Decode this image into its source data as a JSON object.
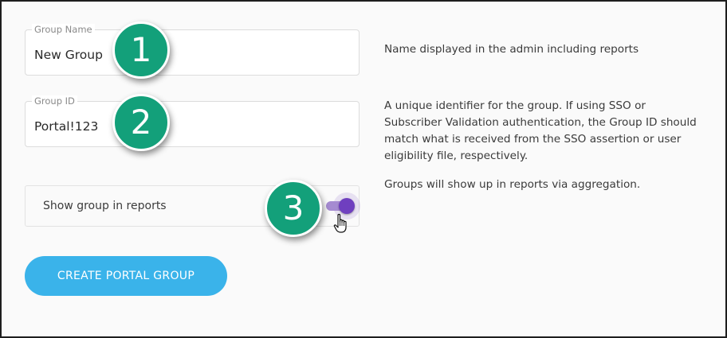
{
  "form": {
    "group_name": {
      "label": "Group Name",
      "value": "New Group"
    },
    "group_id": {
      "label": "Group ID",
      "value": "Portal!123"
    },
    "show_in_reports": {
      "label": "Show group in reports",
      "on": true
    },
    "create_button_label": "CREATE PORTAL GROUP"
  },
  "descriptions": {
    "group_name": "Name displayed in the admin including reports",
    "group_id": "A unique identifier for the group. If using SSO or Subscriber Validation authentication, the Group ID should match what is received from the SSO assertion or user eligibility file, respectively.",
    "show_in_reports": "Groups will show up in reports via aggregation."
  },
  "callouts": [
    "1",
    "2",
    "3"
  ],
  "colors": {
    "callout": "#13a07a",
    "toggle_on": "#6f3fbf",
    "button": "#3ab3ea"
  },
  "icons": {
    "cursor": "hand-pointer-icon"
  }
}
